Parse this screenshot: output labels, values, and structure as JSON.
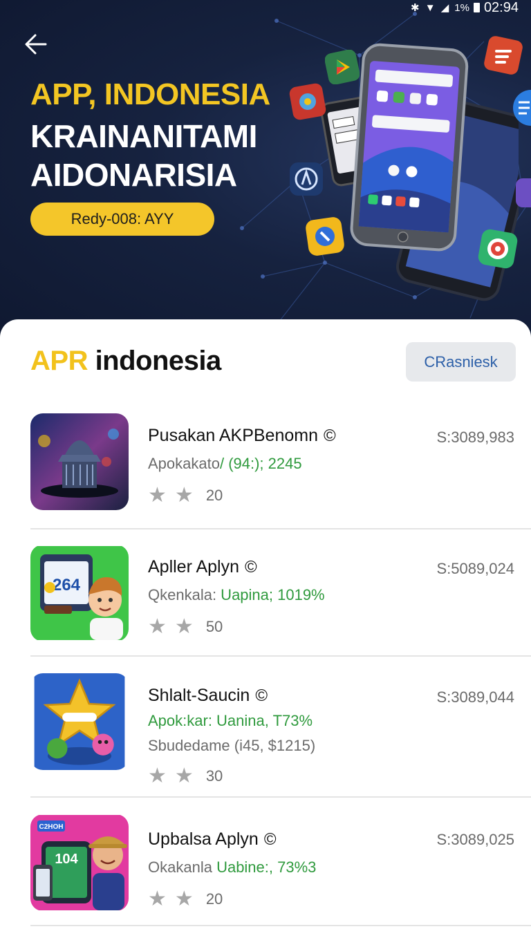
{
  "status_bar": {
    "time": "02:94",
    "battery": "1%"
  },
  "hero": {
    "title_line1": "APP, INDONESIA",
    "title_line2": "KRAINANITAMI",
    "title_line3": "AIDONARISIA",
    "pill_label": "Redy-008: AYY"
  },
  "section": {
    "title_accent": "APR",
    "title_rest": " indonesia",
    "button_label": "CRasniesk"
  },
  "apps": [
    {
      "name": "Pusakan AKPBenomn",
      "price": "S:3089,983",
      "sub1_a": "Apokakato",
      "sub1_b": "/ (94:); 2245",
      "rating": "20"
    },
    {
      "name": "Apller Aplyn",
      "price": "S:5089,024",
      "sub1_a": "Qkenkala:",
      "sub1_b": " Uapina; 1019%",
      "rating": "50"
    },
    {
      "name": "Shlalt-Saucin",
      "price": "S:3089,044",
      "sub1_b": "Apok:kar: Uanina, T73%",
      "sub2": "Sbudedame (i45, $1215)",
      "rating": "30"
    },
    {
      "name": "Upbalsa Aplyn",
      "price": "S:3089,025",
      "sub1_a": "Okakanla",
      "sub1_b": " Uabine:, 73%3",
      "rating": "20"
    }
  ],
  "icon_texts": {
    "app2_badge": "264",
    "app4_badge": "104",
    "app4_tag": "C2HOH"
  },
  "colors": {
    "accent_yellow": "#f2c21c",
    "green": "#2f9a3d",
    "link_blue": "#2c5fa8"
  }
}
